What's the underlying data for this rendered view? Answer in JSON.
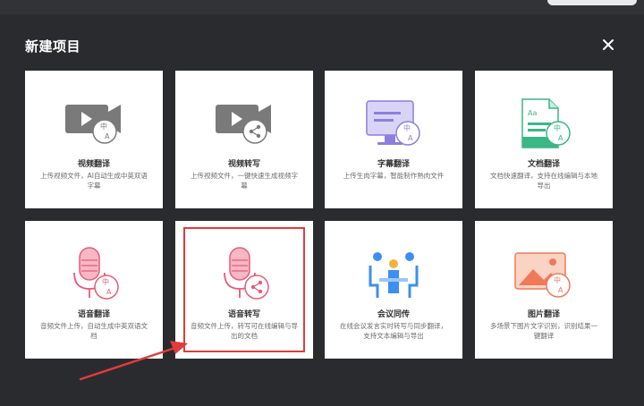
{
  "dialog": {
    "title": "新建项目"
  },
  "cards": [
    {
      "name": "视频翻译",
      "desc": "上传视频文件，AI自动生成中英双语字幕",
      "icon": "video-translate-icon"
    },
    {
      "name": "视频转写",
      "desc": "上传视频文件，一键快速生成视频字幕",
      "icon": "video-transcribe-icon"
    },
    {
      "name": "字幕翻译",
      "desc": "上传生肉字幕，智能制作熟肉文件",
      "icon": "subtitle-translate-icon"
    },
    {
      "name": "文档翻译",
      "desc": "文档快速翻译，支持在线编辑与本地导出",
      "icon": "document-translate-icon"
    },
    {
      "name": "语音翻译",
      "desc": "音频文件上传，自动生成中英双语文档",
      "icon": "voice-translate-icon"
    },
    {
      "name": "语音转写",
      "desc": "音频文件上传，转写可在线编辑与导出的文档",
      "icon": "voice-transcribe-icon"
    },
    {
      "name": "会议同传",
      "desc": "在线会议发言实时转写与同步翻译，支持文本编辑与导出",
      "icon": "meeting-interpret-icon"
    },
    {
      "name": "图片翻译",
      "desc": "多场景下图片文字识别，识别结果一键翻译",
      "icon": "image-translate-icon"
    }
  ],
  "colors": {
    "background": "#2a2b2e",
    "card": "#ffffff",
    "highlight": "#e23b3b",
    "icon_gray": "#7a7a7a",
    "icon_purple": "#8b7fe0",
    "icon_green": "#3bb685",
    "icon_pink": "#e85a78",
    "icon_blue": "#3c8ff0"
  }
}
